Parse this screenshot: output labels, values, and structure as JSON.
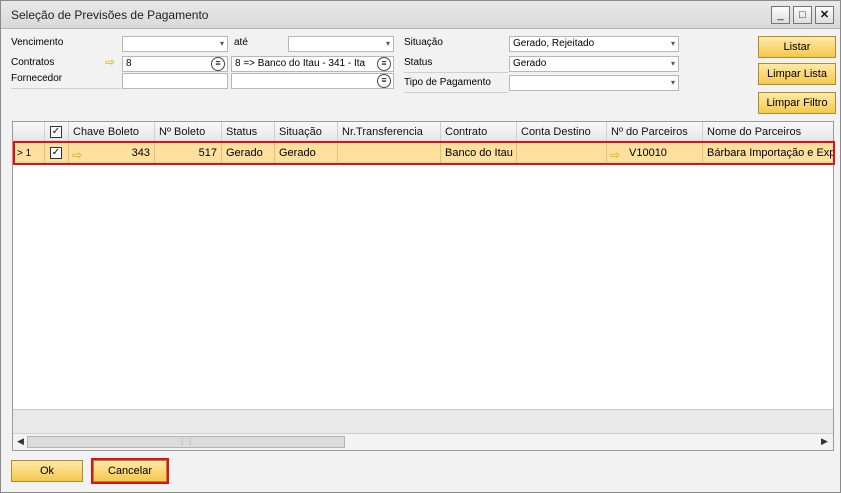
{
  "window": {
    "title": "Seleção de Previsões de Pagamento",
    "minimize": "_",
    "maximize": "□",
    "close": "✕"
  },
  "filters": {
    "vencimento_label": "Vencimento",
    "ate_label": "até",
    "contratos_label": "Contratos",
    "contratos_value": "8",
    "contratos_desc": "8 => Banco do Itau - 341 - Ita",
    "fornecedor_label": "Fornecedor",
    "situacao_label": "Situação",
    "situacao_value": "Gerado, Rejeitado",
    "status_label": "Status",
    "status_value": "Gerado",
    "tipo_pagamento_label": "Tipo de Pagamento",
    "tipo_pagamento_value": ""
  },
  "side_buttons": {
    "listar": "Listar",
    "limpar_lista": "Limpar Lista",
    "limpar_filtro": "Limpar Filtro"
  },
  "grid": {
    "columns": [
      "Chave Boleto",
      "Nº Boleto",
      "Status",
      "Situação",
      "Nr.Transferencia",
      "Contrato",
      "Conta Destino",
      "Nº do Parceiros",
      "Nome do Parceiros"
    ],
    "rows": [
      {
        "row_num": "1",
        "checked": "✓",
        "chave_boleto": "343",
        "n_boleto": "517",
        "status": "Gerado",
        "situacao": "Gerado",
        "nr_transferencia": "",
        "contrato": "Banco do Itau",
        "conta_destino": "",
        "n_parceiros": "V10010",
        "nome_parceiros": "Bárbara Importação e Expo"
      }
    ],
    "header_check": "✓"
  },
  "footer": {
    "ok": "Ok",
    "cancelar": "Cancelar"
  },
  "colors": {
    "accent": "#f4c94e",
    "selected_row": "#fddf9e",
    "highlight": "#e0101a",
    "link_arrow": "#e0a800"
  }
}
